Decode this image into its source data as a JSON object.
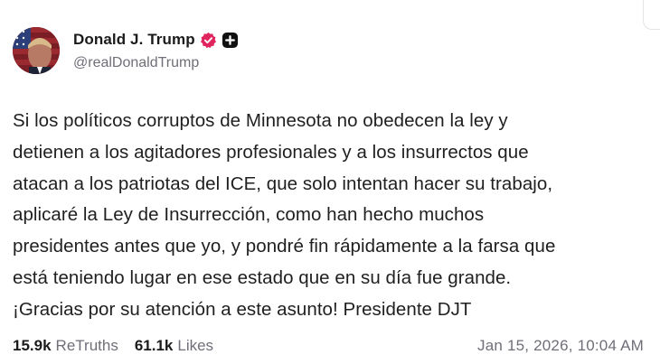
{
  "post": {
    "author": {
      "display_name": "Donald J. Trump",
      "handle": "@realDonaldTrump",
      "verified_icon": "verified-badge-icon",
      "follow_icon": "plus-icon",
      "badge_color": "#e0245e"
    },
    "body_lines": [
      "Si los políticos corruptos de Minnesota no obedecen la ley y",
      "detienen a los agitadores profesionales y a los insurrectos que",
      "atacan a los patriotas del ICE, que solo intentan hacer su trabajo,",
      "aplicaré la Ley de Insurrección, como han hecho muchos",
      "presidentes antes que yo, y pondré fin rápidamente a la farsa que",
      "está teniendo lugar en ese estado que en su día fue grande.",
      "¡Gracias por su atención a este asunto! Presidente DJT"
    ],
    "stats": {
      "retruths_count": "15.9k",
      "retruths_label": "ReTruths",
      "likes_count": "61.1k",
      "likes_label": "Likes"
    },
    "timestamp": "Jan 15, 2026, 10:04 AM"
  }
}
